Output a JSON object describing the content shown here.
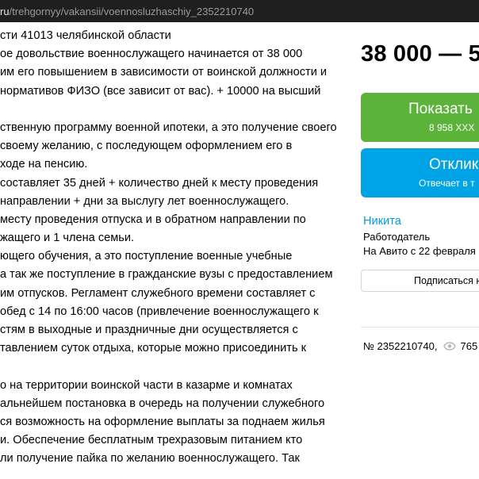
{
  "browser": {
    "url_host": "ru",
    "url_path": "/trehgornyy/vakansii/voennosluzhaschiy_2352210740"
  },
  "description_lines": [
    "сти 41013 челябинской области",
    "ое довольствие военнослужащего начинается от 38 000",
    "им его повышением в зависимости от воинской должности и",
    "нормативов ФИЗО (все зависит от вас). + 10000 на высший",
    "",
    "ственную программу военной ипотеки, а это получение своего",
    "своему желанию, с последующем оформлением его в",
    "ходе на пенсию.",
    "составляет 35 дней + количество дней к месту проведения",
    "направлении + дни за выслугу лет военнослужащего.",
    "месту проведения отпуска и в обратном направлении по",
    "жащего и 1 члена семьи.",
    "ющего обучения, а это поступление военные учебные",
    "а так же поступление в гражданские вузы с предоставлением",
    "им отпусков. Регламент служебного времени составляет с",
    "обед с 14 по 16:00 часов (привлечение военнослужащего к",
    "стям в выходные и праздничные дни осуществляется с",
    "тавлением суток отдыха, которые можно присоединить к",
    "",
    "о на территории воинской части в казарме и комнатах",
    "альнейшем постановка в очередь на получении служебного",
    "ся возможность на оформление выплаты за поднаем жилья",
    "и. Обеспечение бесплатным трехразовым питанием кто",
    "ли получение пайка по желанию военнослужащего. Так"
  ],
  "sidebar": {
    "price": "38 000 — 5",
    "show_phone_label": "Показать",
    "show_phone_sub": "8 958 XXX",
    "respond_label": "Отклик",
    "respond_sub": "Отвечает в т",
    "seller_name": "Никита",
    "seller_role": "Работодатель",
    "seller_since": "На Авито с 22 февраля 2",
    "subscribe_label": "Подписаться н",
    "ad_number": "№ 2352210740,",
    "views": "765"
  },
  "colors": {
    "green_button": "#5cb33a",
    "blue_button": "#00a3e6",
    "link": "#0099e0"
  },
  "icons": [
    "eye-icon"
  ]
}
